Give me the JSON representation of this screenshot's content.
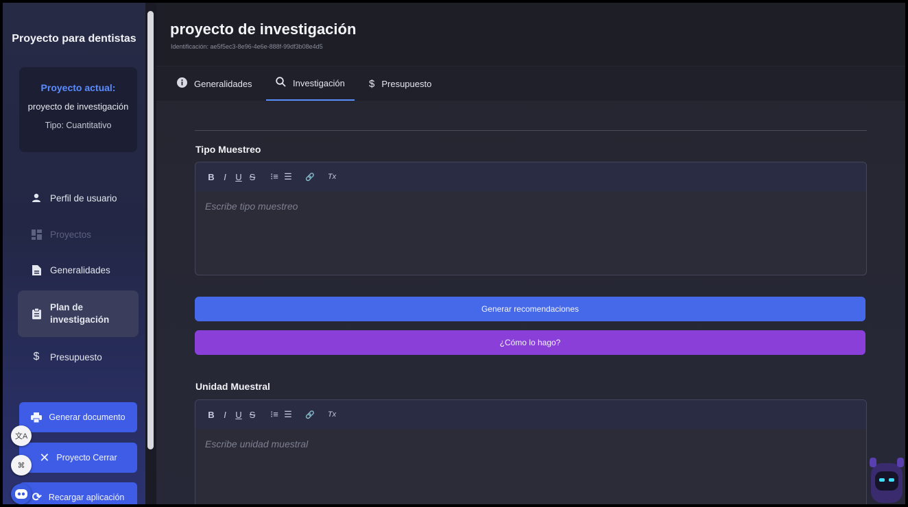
{
  "sidebar": {
    "app_title": "Proyecto para dentistas",
    "project_card": {
      "label": "Proyecto actual:",
      "name": "proyecto de investigación",
      "type": "Tipo: Cuantitativo"
    },
    "nav": [
      {
        "label": "Perfil de usuario",
        "icon": "user-icon"
      },
      {
        "label": "Proyectos",
        "icon": "grid-icon"
      },
      {
        "label": "Generalidades",
        "icon": "document-icon"
      },
      {
        "label": "Plan de investigación",
        "icon": "clipboard-icon"
      },
      {
        "label": "Presupuesto",
        "icon": "dollar-icon"
      }
    ],
    "buttons": {
      "generate_doc": "Generar documento",
      "close_project": "Proyecto Cerrar",
      "reload_app": "Recargar aplicación"
    }
  },
  "header": {
    "title": "proyecto de investigación",
    "id_text": "Identificación: ae5f5ec3-8e96-4e6e-888f-99df3b08e4d5"
  },
  "tabs": [
    {
      "label": "Generalidades",
      "icon": "info-icon"
    },
    {
      "label": "Investigación",
      "icon": "search-icon",
      "active": true
    },
    {
      "label": "Presupuesto",
      "icon": "dollar-icon"
    }
  ],
  "sections": {
    "tipo_muestreo": {
      "title": "Tipo Muestreo",
      "placeholder": "Escribe tipo muestreo"
    },
    "unidad_muestral": {
      "title": "Unidad Muestral",
      "placeholder": "Escribe unidad muestral"
    }
  },
  "toolbar": {
    "bold": "B",
    "italic": "I",
    "underline": "U",
    "strike": "S",
    "ordered_list": "⁝≡",
    "bullet_list": "☰",
    "link": "🔗",
    "clear": "Tx"
  },
  "actions": {
    "generate": "Generar recomendaciones",
    "how": "¿Cómo lo hago?"
  },
  "colors": {
    "accent": "#4569e8",
    "purple": "#8a3fd9",
    "card_label": "#5b8cff"
  }
}
